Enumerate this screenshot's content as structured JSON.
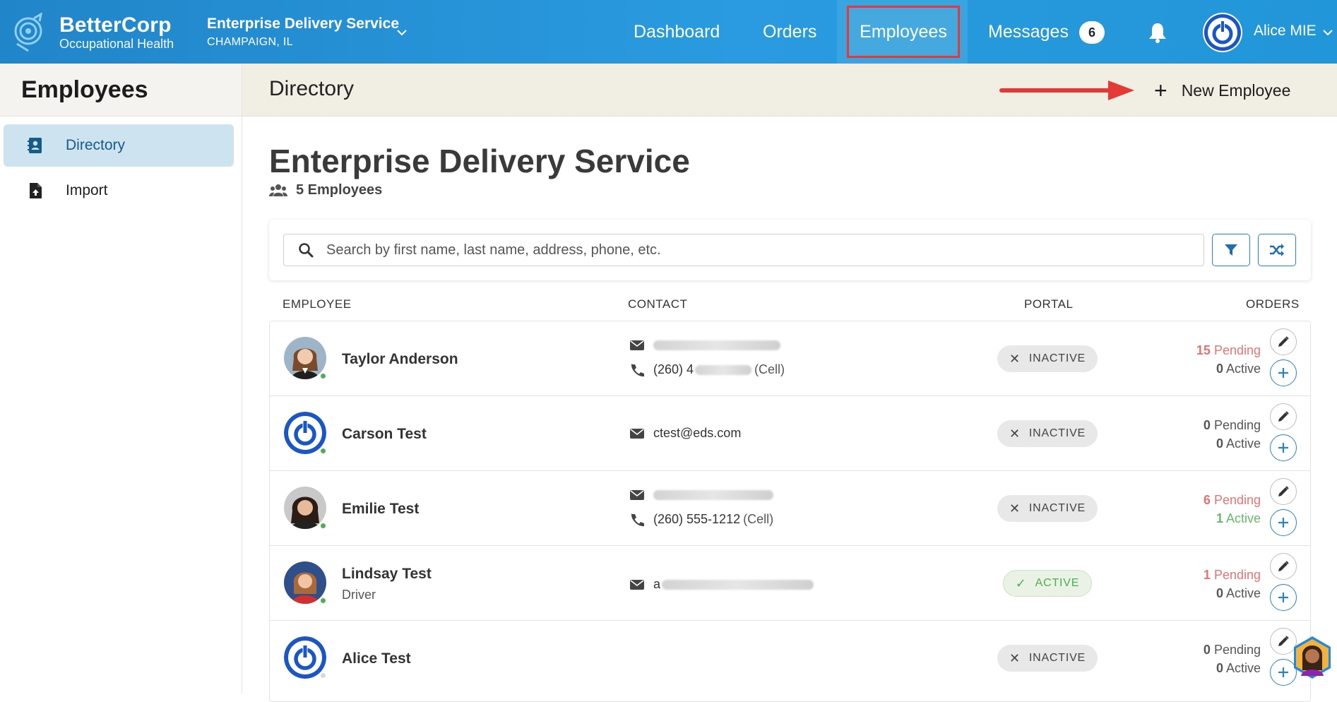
{
  "header": {
    "brand_name": "BetterCorp",
    "brand_sub": "Occupational Health",
    "org_name": "Enterprise Delivery Service",
    "org_location": "CHAMPAIGN, IL",
    "nav": {
      "dashboard": "Dashboard",
      "orders": "Orders",
      "employees": "Employees",
      "messages": "Messages"
    },
    "messages_count": "6",
    "user_name": "Alice MIE",
    "accent": "#2196d8"
  },
  "sidebar": {
    "title": "Employees",
    "items": [
      {
        "label": "Directory",
        "icon": "contact-book-icon",
        "active": true
      },
      {
        "label": "Import",
        "icon": "file-upload-icon",
        "active": false
      }
    ]
  },
  "page": {
    "title": "Directory",
    "new_employee_label": "New Employee",
    "company": "Enterprise Delivery Service",
    "employee_count": "5 Employees",
    "search_placeholder": "Search by first name, last name, address, phone, etc."
  },
  "columns": {
    "employee": "EMPLOYEE",
    "contact": "CONTACT",
    "portal": "PORTAL",
    "orders": "ORDERS"
  },
  "employees": [
    {
      "name": "Taylor Anderson",
      "role": "",
      "email": "",
      "phone_prefix": "(260) 4",
      "phone_tag": "(Cell)",
      "portal": "INACTIVE",
      "pending": "15",
      "pending_label": "Pending",
      "active": "0",
      "active_label": "Active"
    },
    {
      "name": "Carson Test",
      "role": "",
      "email": "ctest@eds.com",
      "phone_prefix": "",
      "phone_tag": "",
      "portal": "INACTIVE",
      "pending": "0",
      "pending_label": "Pending",
      "active": "0",
      "active_label": "Active"
    },
    {
      "name": "Emilie Test",
      "role": "",
      "email": "",
      "phone_prefix": "(260) 555-1212",
      "phone_tag": "(Cell)",
      "portal": "INACTIVE",
      "pending": "6",
      "pending_label": "Pending",
      "active": "1",
      "active_label": "Active"
    },
    {
      "name": "Lindsay Test",
      "role": "Driver",
      "email": "a",
      "phone_prefix": "",
      "phone_tag": "",
      "portal": "ACTIVE",
      "pending": "1",
      "pending_label": "Pending",
      "active": "0",
      "active_label": "Active"
    },
    {
      "name": "Alice Test",
      "role": "",
      "email": "",
      "phone_prefix": "",
      "phone_tag": "",
      "portal": "INACTIVE",
      "pending": "0",
      "pending_label": "Pending",
      "active": "0",
      "active_label": "Active"
    }
  ]
}
